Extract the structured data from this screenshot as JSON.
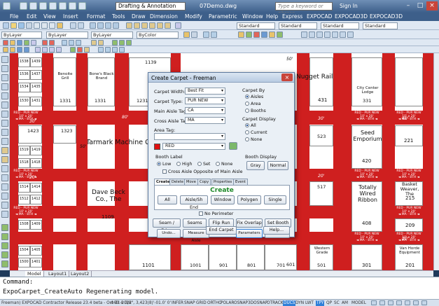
{
  "window": {
    "workspace": "Drafting & Annotation",
    "file_title": "07Demo.dwg",
    "search_placeholder": "Type a keyword or phrase",
    "sign_in": "Sign In"
  },
  "menu": [
    "File",
    "Edit",
    "View",
    "Insert",
    "Format",
    "Tools",
    "Draw",
    "Dimension",
    "Modify",
    "Parametric",
    "Window",
    "Help",
    "Express",
    "EXPOCAD",
    "EXPOCAD3D",
    "EXPOCAD3D"
  ],
  "toolbars": {
    "layer": "ByLayer",
    "linetype": "ByLayer",
    "lineweight": "ByLayer",
    "color": "ByColor",
    "textstyle": "Standard",
    "dimstyle": "Standard",
    "tablestyle": "Standard",
    "mlstyle": "Standard"
  },
  "booths": {
    "left_column": [
      "1538",
      "1536",
      "1534",
      "1532",
      "1530",
      "1423",
      "1519",
      "1518",
      "1516",
      "1514",
      "1512",
      "1510",
      "1508",
      "1504",
      "1502",
      "1500"
    ],
    "left_column_b": [
      "1439",
      "1437",
      "1435",
      "1433",
      "1431",
      "1323",
      "1419",
      "1418",
      "1416",
      "1414",
      "1412",
      "1411",
      "1409",
      "1405",
      "1403",
      "1401"
    ],
    "top_row": [
      "1338",
      "1336",
      "1334",
      "1332",
      "1331",
      "1139",
      "1138"
    ],
    "names": {
      "benoits": "Benoite Grill",
      "bones": "Bone's Black Brand",
      "nugget": "Nugget Rail",
      "tarmak": "Tarmark Machine Co",
      "seed": "Seed Emporium",
      "dave": "Dave Beck Co., The",
      "totally": "Totally Wired Ribbon",
      "basket": "Basket Weaver, The",
      "city": "City Center Lodge",
      "van": "Van Horde Equipment",
      "western": "Western Grade",
      "windstone": "Wind..."
    },
    "numbers": {
      "n1109": "1109",
      "n1101": "1101",
      "n1001": "1001",
      "n901": "901",
      "n801": "801",
      "n701": "701",
      "n601": "601",
      "n501": "501",
      "n431": "431",
      "n331": "331",
      "n420": "420",
      "n408": "408",
      "n523": "523",
      "n517": "517",
      "n221": "221",
      "n215": "215",
      "n209": "209",
      "n301": "301",
      "n201": "201",
      "n1231": "1231",
      "n1331": "1331",
      "n1323": "1323",
      "n1139": "1139"
    },
    "aisle_labels": [
      "30'",
      "20'",
      "50'",
      "80'",
      "30'",
      "40'",
      "20'",
      "30'",
      "20'",
      "40'"
    ],
    "carpet_tag": "RED - PUR NEW\n10' x 20'\n◄ MA - 8TH ◄"
  },
  "dialog": {
    "title": "Create Carpet - Freeman",
    "carpet_width_label": "Carpet Width:",
    "carpet_width_value": "Best Fit",
    "carpet_type_label": "Carpet Type:",
    "carpet_type_value": "PUR NEW",
    "main_aisle_label": "Main Aisle Tag:",
    "main_aisle_value": "CA",
    "cross_aisle_label": "Cross Aisle Tag:",
    "cross_aisle_value": "MA",
    "area_tag_label": "Area Tag:",
    "area_tag_value": "",
    "color_value": "RED",
    "carpet_by_label": "Carpet By",
    "carpet_by_options": [
      "Aisles",
      "Area",
      "Booths"
    ],
    "carpet_display_label": "Carpet Display",
    "carpet_display_options": [
      "All",
      "Current",
      "None"
    ],
    "booth_label_title": "Booth Label",
    "booth_label_options": [
      "Low",
      "High",
      "Set",
      "None"
    ],
    "cross_aisle_check": "Cross Aisle Opposite of Main Aisle",
    "booth_display_title": "Booth Display",
    "gray_button": "Gray",
    "normal_button": "Normal",
    "tabs": [
      "Create",
      "Delete",
      "Move",
      "Copy",
      "Properties",
      "Event"
    ],
    "panel_title": "Create",
    "panel_buttons": [
      "All",
      "Aisle/Sh End",
      "Window",
      "Polygen",
      "Single"
    ],
    "no_perimeter": "No Perimeter",
    "row1_buttons": [
      "Seam / Edge",
      "Seams",
      "Flip Run",
      "Fix Overlap",
      "Set Booth #s"
    ],
    "row2_buttons": [
      "Undo...",
      "Measure Aisle",
      "Parameters",
      "Options"
    ],
    "end_carpet": "End Carpet",
    "help": "Help..."
  },
  "layout_tabs": [
    "Model",
    "Layout1",
    "Layout2"
  ],
  "command": {
    "line1": "Command:",
    "line2": "ExpoCarpet_CreateAuto Regenerating model."
  },
  "status": {
    "release": "Freeman) EXPOCAD Contractor Release 23.4 beta - Oct 31 2012",
    "coords": "440'-0 3/8\", 3,423(8)'-01.0' 0'",
    "toggles": [
      "INFER",
      "SNAP",
      "GRID",
      "ORTHO",
      "POLAR",
      "OSNAP",
      "3DOSNAP",
      "OTRACK",
      "DUCS",
      "DYN",
      "LWT",
      "TPY",
      "QP",
      "SC",
      "AM"
    ],
    "model": "MODEL"
  },
  "colors": {
    "carpet": "#cf1f1f",
    "accent": "#2f7fd8"
  }
}
